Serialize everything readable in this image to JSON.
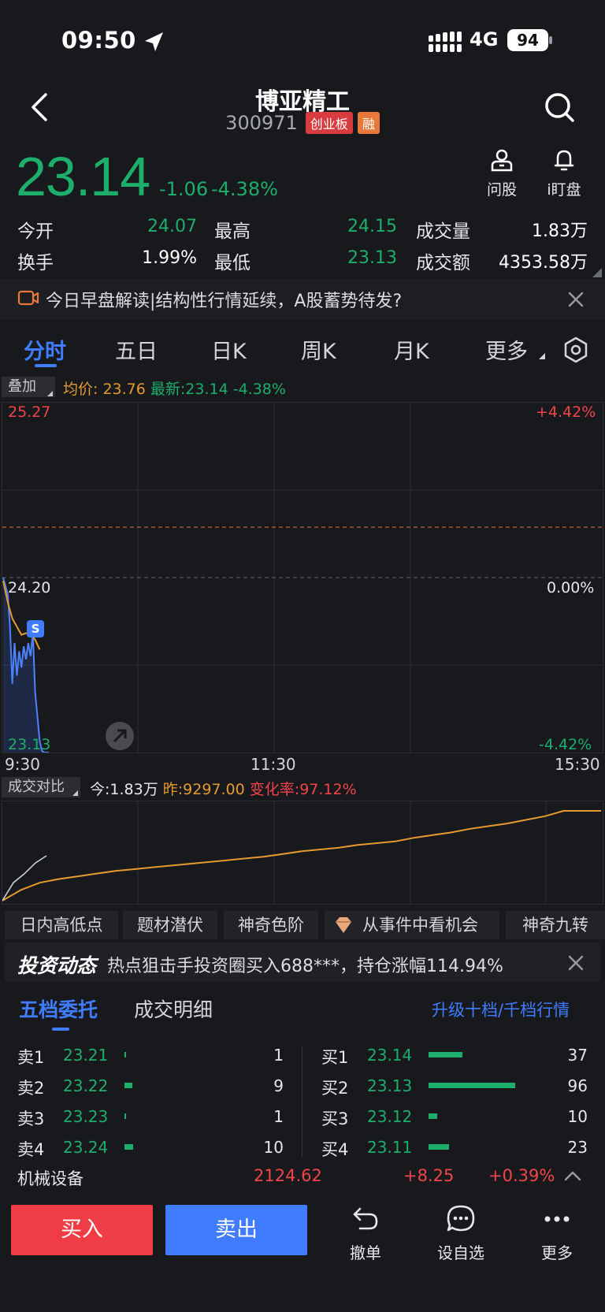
{
  "status_bar": {
    "time": "09:50",
    "network": "4G",
    "battery": "94"
  },
  "header": {
    "name": "博亚精工",
    "code": "300971",
    "board_tag": "创业板",
    "margin_tag": "融"
  },
  "quote": {
    "price": "23.14",
    "change": "-1.06",
    "change_pct": "-4.38%"
  },
  "side_actions": [
    {
      "label": "问股",
      "icon": "person-icon"
    },
    {
      "label": "i盯盘",
      "icon": "bell-icon"
    }
  ],
  "stats": [
    {
      "label": "今开",
      "value": "24.07"
    },
    {
      "label": "最高",
      "value": "24.15"
    },
    {
      "label": "成交量",
      "value": "1.83万"
    },
    {
      "label": "换手",
      "value": "1.99%"
    },
    {
      "label": "最低",
      "value": "23.13"
    },
    {
      "label": "成交额",
      "value": "4353.58万"
    }
  ],
  "news": {
    "text": "今日早盘解读|结构性行情延续，A股蓄势待发?"
  },
  "tabs": [
    "分时",
    "五日",
    "日K",
    "周K",
    "月K",
    "更多"
  ],
  "chart": {
    "overlay_label": "叠加",
    "avg_label": "均价: 23.76",
    "latest_label": "最新:23.14 -4.38%",
    "y_high": "25.27",
    "y_mid": "24.20",
    "y_low": "23.13",
    "pct_high": "+4.42%",
    "pct_mid": "0.00%",
    "pct_low": "-4.42%",
    "time_start": "9:30",
    "time_mid": "11:30",
    "time_end": "15:30",
    "marker": "S"
  },
  "chart_data": {
    "type": "line",
    "y_range": [
      23.13,
      25.27
    ],
    "series": [
      {
        "name": "price",
        "x": [
          0,
          1,
          2,
          3,
          4,
          5,
          6,
          7,
          8,
          9,
          10,
          11,
          12,
          13,
          14,
          15,
          16,
          17,
          18,
          19,
          20
        ],
        "values": [
          24.2,
          24.15,
          24.1,
          23.9,
          23.55,
          23.8,
          23.6,
          23.75,
          23.65,
          23.78,
          23.7,
          23.8,
          23.72,
          23.86,
          23.5,
          23.35,
          23.2,
          23.14,
          23.13,
          23.13,
          23.13
        ]
      },
      {
        "name": "avg",
        "x": [
          0,
          2,
          4,
          6,
          8,
          10,
          12,
          14,
          16
        ],
        "values": [
          24.18,
          24.05,
          23.95,
          23.9,
          23.85,
          23.86,
          23.86,
          23.82,
          23.76
        ]
      }
    ]
  },
  "volume": {
    "button_label": "成交对比",
    "today": "今:1.83万",
    "yesterday": "昨:9297.00",
    "change_rate": "变化率:97.12%"
  },
  "volume_data": {
    "type": "line",
    "series": [
      {
        "name": "yesterday",
        "values": [
          0.0,
          0.12,
          0.2,
          0.24,
          0.27,
          0.3,
          0.33,
          0.35,
          0.37,
          0.39,
          0.41,
          0.43,
          0.45,
          0.47,
          0.49,
          0.52,
          0.55,
          0.57,
          0.59,
          0.62,
          0.64,
          0.66,
          0.7,
          0.73,
          0.76,
          0.8,
          0.83,
          0.86,
          0.9,
          0.94,
          1.0,
          1.0,
          1.0
        ]
      },
      {
        "name": "today",
        "values": [
          0.0,
          0.2,
          0.3,
          0.42,
          0.5
        ]
      }
    ]
  },
  "feature_chips": [
    "日内高低点",
    "题材潜伏",
    "神奇色阶",
    "从事件中看机会",
    "神奇九转"
  ],
  "invest": {
    "title": "投资动态",
    "text": "热点狙击手投资圈买入688***，持仓涨幅114.94%"
  },
  "orderbook": {
    "tab_active": "五档委托",
    "tab_other": "成交明细",
    "upgrade": "升级十档/千档行情",
    "asks": [
      {
        "label": "卖1",
        "price": "23.21",
        "qty": "1",
        "fraction": 0.01
      },
      {
        "label": "卖2",
        "price": "23.22",
        "qty": "9",
        "fraction": 0.09
      },
      {
        "label": "卖3",
        "price": "23.23",
        "qty": "1",
        "fraction": 0.01
      },
      {
        "label": "卖4",
        "price": "23.24",
        "qty": "10",
        "fraction": 0.1
      }
    ],
    "bids": [
      {
        "label": "买1",
        "price": "23.14",
        "qty": "37",
        "fraction": 0.39
      },
      {
        "label": "买2",
        "price": "23.13",
        "qty": "96",
        "fraction": 1.0
      },
      {
        "label": "买3",
        "price": "23.12",
        "qty": "10",
        "fraction": 0.1
      },
      {
        "label": "买4",
        "price": "23.11",
        "qty": "23",
        "fraction": 0.24
      }
    ]
  },
  "sector": {
    "name": "机械设备",
    "value": "2124.62",
    "change": "+8.25",
    "change_pct": "+0.39%"
  },
  "bottom": {
    "buy": "买入",
    "sell": "卖出",
    "tools": [
      "撤单",
      "设自选",
      "更多"
    ]
  }
}
